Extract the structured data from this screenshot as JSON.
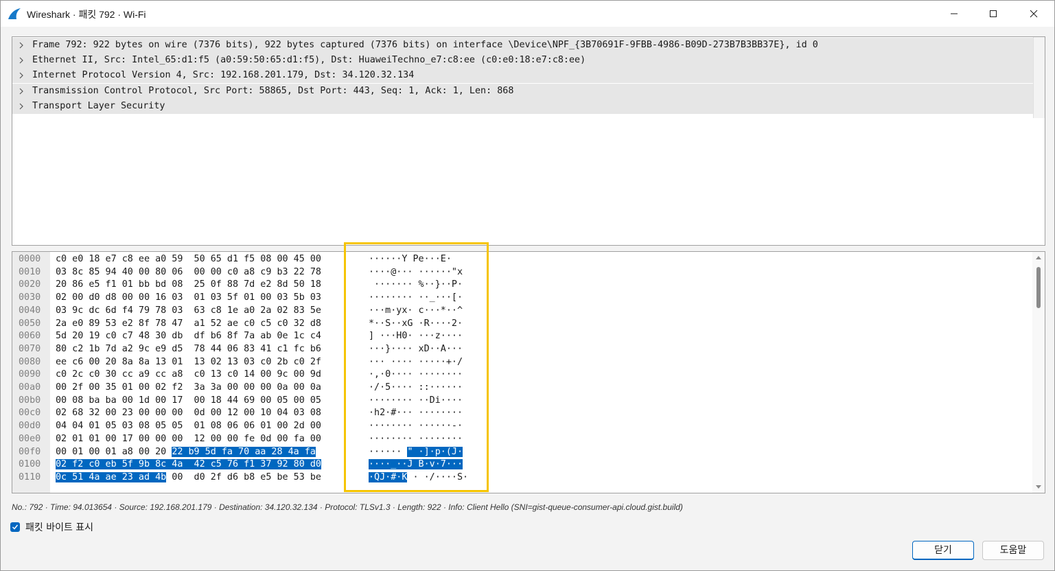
{
  "window": {
    "title": "Wireshark · 패킷 792 · Wi-Fi"
  },
  "colors": {
    "accent": "#0067c0",
    "highlight_box": "#f5c400"
  },
  "tree": {
    "rows": [
      "Frame 792: 922 bytes on wire (7376 bits), 922 bytes captured (7376 bits) on interface \\Device\\NPF_{3B70691F-9FBB-4986-B09D-273B7B3BB37E}, id 0",
      "Ethernet II, Src: Intel_65:d1:f5 (a0:59:50:65:d1:f5), Dst: HuaweiTechno_e7:c8:ee (c0:e0:18:e7:c8:ee)",
      "Internet Protocol Version 4, Src: 192.168.201.179, Dst: 34.120.32.134",
      "Transmission Control Protocol, Src Port: 58865, Dst Port: 443, Seq: 1, Ack: 1, Len: 868",
      "Transport Layer Security"
    ]
  },
  "hex": {
    "lines": [
      {
        "offset": "0000",
        "bytes": "c0 e0 18 e7 c8 ee a0 59  50 65 d1 f5 08 00 45 00",
        "sel_bytes": "",
        "ascii": "······Y Pe···E·",
        "sel_ascii": ""
      },
      {
        "offset": "0010",
        "bytes": "03 8c 85 94 40 00 80 06  00 00 c0 a8 c9 b3 22 78",
        "sel_bytes": "",
        "ascii": "····@··· ······\"x",
        "sel_ascii": ""
      },
      {
        "offset": "0020",
        "bytes": "20 86 e5 f1 01 bb bd 08  25 0f 88 7d e2 8d 50 18",
        "sel_bytes": "",
        "ascii": " ······· %··}··P·",
        "sel_ascii": ""
      },
      {
        "offset": "0030",
        "bytes": "02 00 d0 d8 00 00 16 03  01 03 5f 01 00 03 5b 03",
        "sel_bytes": "",
        "ascii": "········ ··_···[·",
        "sel_ascii": ""
      },
      {
        "offset": "0040",
        "bytes": "03 9c dc 6d f4 79 78 03  63 c8 1e a0 2a 02 83 5e",
        "sel_bytes": "",
        "ascii": "···m·yx· c···*··^",
        "sel_ascii": ""
      },
      {
        "offset": "0050",
        "bytes": "2a e0 89 53 e2 8f 78 47  a1 52 ae c0 c5 c0 32 d8",
        "sel_bytes": "",
        "ascii": "*··S··xG ·R····2·",
        "sel_ascii": ""
      },
      {
        "offset": "0060",
        "bytes": "5d 20 19 c0 c7 48 30 db  df b6 8f 7a ab 0e 1c c4",
        "sel_bytes": "",
        "ascii": "] ···H0· ···z····",
        "sel_ascii": ""
      },
      {
        "offset": "0070",
        "bytes": "80 c2 1b 7d a2 9c e9 d5  78 44 06 83 41 c1 fc b6",
        "sel_bytes": "",
        "ascii": "···}···· xD··A···",
        "sel_ascii": ""
      },
      {
        "offset": "0080",
        "bytes": "ee c6 00 20 8a 8a 13 01  13 02 13 03 c0 2b c0 2f",
        "sel_bytes": "",
        "ascii": "··· ···· ·····+·/",
        "sel_ascii": ""
      },
      {
        "offset": "0090",
        "bytes": "c0 2c c0 30 cc a9 cc a8  c0 13 c0 14 00 9c 00 9d",
        "sel_bytes": "",
        "ascii": "·,·0···· ········",
        "sel_ascii": ""
      },
      {
        "offset": "00a0",
        "bytes": "00 2f 00 35 01 00 02 f2  3a 3a 00 00 00 0a 00 0a",
        "sel_bytes": "",
        "ascii": "·/·5···· ::······",
        "sel_ascii": ""
      },
      {
        "offset": "00b0",
        "bytes": "00 08 ba ba 00 1d 00 17  00 18 44 69 00 05 00 05",
        "sel_bytes": "",
        "ascii": "········ ··Di····",
        "sel_ascii": ""
      },
      {
        "offset": "00c0",
        "bytes": "02 68 32 00 23 00 00 00  0d 00 12 00 10 04 03 08",
        "sel_bytes": "",
        "ascii": "·h2·#··· ········",
        "sel_ascii": ""
      },
      {
        "offset": "00d0",
        "bytes": "04 04 01 05 03 08 05 05  01 08 06 06 01 00 2d 00",
        "sel_bytes": "",
        "ascii": "········ ······-·",
        "sel_ascii": ""
      },
      {
        "offset": "00e0",
        "bytes": "02 01 01 00 17 00 00 00  12 00 00 fe 0d 00 fa 00",
        "sel_bytes": "",
        "ascii": "········ ········",
        "sel_ascii": ""
      },
      {
        "offset": "00f0",
        "bytes": "00 01 00 01 a8 00 20 ",
        "sel_bytes": "22 b9 5d fa 70 aa 28 4a fa",
        "ascii": "······ ",
        "sel_ascii": "\" ·]·p·(J·"
      },
      {
        "offset": "0100",
        "bytes": "",
        "sel_bytes": "02 f2 c0 eb 5f 9b 8c 4a  42 c5 76 f1 37 92 80 d0",
        "ascii": "",
        "sel_ascii": "····_··J B·v·7···"
      },
      {
        "offset": "0110",
        "bytes_pre": "",
        "sel_bytes": "0c 51 4a ae 23 ad 4b",
        "bytes": " 00  d0 2f d6 b8 e5 be 53 be",
        "sel_ascii": "·QJ·#·K",
        "ascii": "· ·/····S·"
      }
    ]
  },
  "status": {
    "text": "No.: 792 · Time: 94.013654 · Source: 192.168.201.179 · Destination: 34.120.32.134 · Protocol: TLSv1.3 · Length: 922 · Info: Client Hello (SNI=gist-queue-consumer-api.cloud.gist.build)"
  },
  "options": {
    "show_bytes_label": "패킷 바이트 표시",
    "show_bytes_checked": true
  },
  "buttons": {
    "close_label": "닫기",
    "help_label": "도움말"
  }
}
